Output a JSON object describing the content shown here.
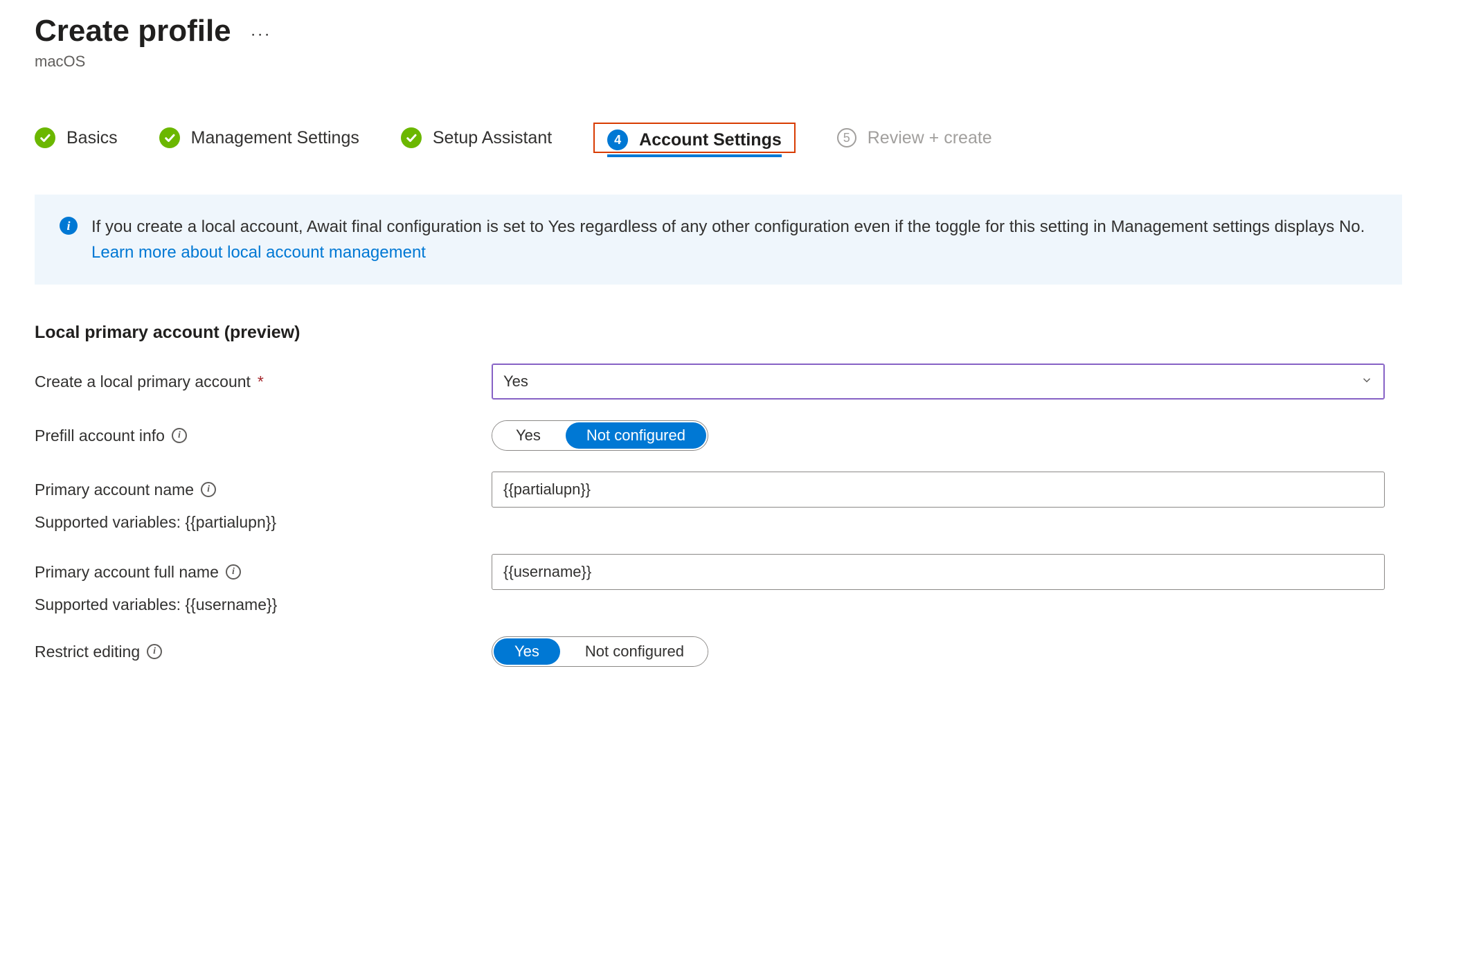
{
  "header": {
    "title": "Create profile",
    "subtitle": "macOS"
  },
  "steps": {
    "s1": "Basics",
    "s2": "Management Settings",
    "s3": "Setup Assistant",
    "s4_num": "4",
    "s4": "Account Settings",
    "s5_num": "5",
    "s5": "Review + create"
  },
  "banner": {
    "text": "If you create a local account, Await final configuration is set to Yes regardless of any other configuration even if the toggle for this setting in Management settings displays No. ",
    "link": "Learn more about local account management"
  },
  "section": {
    "heading": "Local primary account (preview)"
  },
  "form": {
    "create_label": "Create a local primary account",
    "create_value": "Yes",
    "prefill_label": "Prefill account info",
    "prefill_yes": "Yes",
    "prefill_not": "Not configured",
    "acct_name_label": "Primary account name",
    "acct_name_value": "{{partialupn}}",
    "acct_name_hint": "Supported variables: {{partialupn}}",
    "full_name_label": "Primary account full name",
    "full_name_value": "{{username}}",
    "full_name_hint": "Supported variables: {{username}}",
    "restrict_label": "Restrict editing",
    "restrict_yes": "Yes",
    "restrict_not": "Not configured"
  }
}
